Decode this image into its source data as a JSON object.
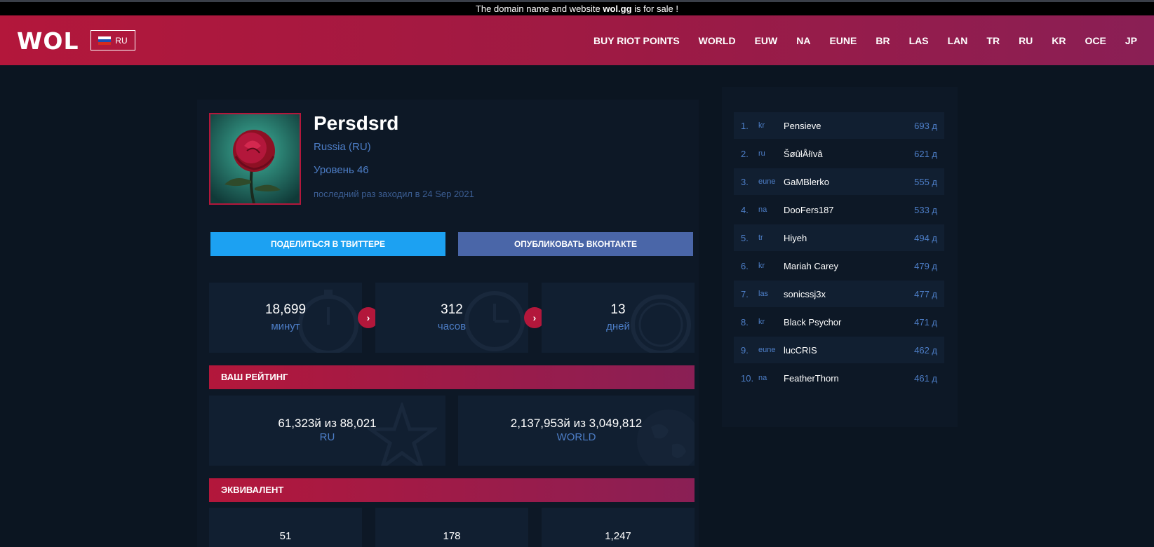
{
  "sale_bar": {
    "prefix": "The domain name and website ",
    "domain": "wol.gg",
    "suffix": " is for sale !"
  },
  "header": {
    "logo": "WOL",
    "lang": "RU",
    "nav": [
      "BUY RIOT POINTS",
      "WORLD",
      "EUW",
      "NA",
      "EUNE",
      "BR",
      "LAS",
      "LAN",
      "TR",
      "RU",
      "KR",
      "OCE",
      "JP"
    ]
  },
  "profile": {
    "name": "Persdsrd",
    "country": "Russia (RU)",
    "level": "Уровень 46",
    "last_seen": "последний раз заходил в 24 Sep 2021"
  },
  "share": {
    "twitter": "ПОДЕЛИТЬСЯ В ТВИТТЕРЕ",
    "vk": "ОПУБЛИКОВАТЬ ВКОНТАКТЕ"
  },
  "time_stats": [
    {
      "value": "18,699",
      "label": "минут"
    },
    {
      "value": "312",
      "label": "часов"
    },
    {
      "value": "13",
      "label": "дней"
    }
  ],
  "rating": {
    "title": "ВАШ РЕЙТИНГ",
    "entries": [
      {
        "value": "61,323й из 88,021",
        "label": "RU"
      },
      {
        "value": "2,137,953й из 3,049,812",
        "label": "WORLD"
      }
    ]
  },
  "equivalent": {
    "title": "ЭКВИВАЛЕНТ",
    "values": [
      "51",
      "178",
      "1,247"
    ]
  },
  "leaderboard": [
    {
      "pos": "1.",
      "region": "kr",
      "name": "Pensieve",
      "days": "693 д"
    },
    {
      "pos": "2.",
      "region": "ru",
      "name": "ŠøûłÅłïvâ",
      "days": "621 д"
    },
    {
      "pos": "3.",
      "region": "eune",
      "name": "GaMBlerko",
      "days": "555 д"
    },
    {
      "pos": "4.",
      "region": "na",
      "name": "DooFers187",
      "days": "533 д"
    },
    {
      "pos": "5.",
      "region": "tr",
      "name": "Hiyeh",
      "days": "494 д"
    },
    {
      "pos": "6.",
      "region": "kr",
      "name": "Mariah Carey",
      "days": "479 д"
    },
    {
      "pos": "7.",
      "region": "las",
      "name": "sonicssj3x",
      "days": "477 д"
    },
    {
      "pos": "8.",
      "region": "kr",
      "name": "Black Psychor",
      "days": "471 д"
    },
    {
      "pos": "9.",
      "region": "eune",
      "name": "lucCRIS",
      "days": "462 д"
    },
    {
      "pos": "10.",
      "region": "na",
      "name": "FeatherThorn",
      "days": "461 д"
    }
  ],
  "colors": {
    "accent": "#b3173b",
    "background": "#0b1521",
    "panel": "#111f31",
    "link_blue": "#4d7ec7",
    "twitter": "#1ca1f2",
    "vk": "#4a66a8"
  },
  "icons": [
    "stopwatch-icon",
    "clock-icon",
    "clock-alt-icon",
    "star-icon",
    "globe-icon",
    "chevron-right-icon"
  ]
}
